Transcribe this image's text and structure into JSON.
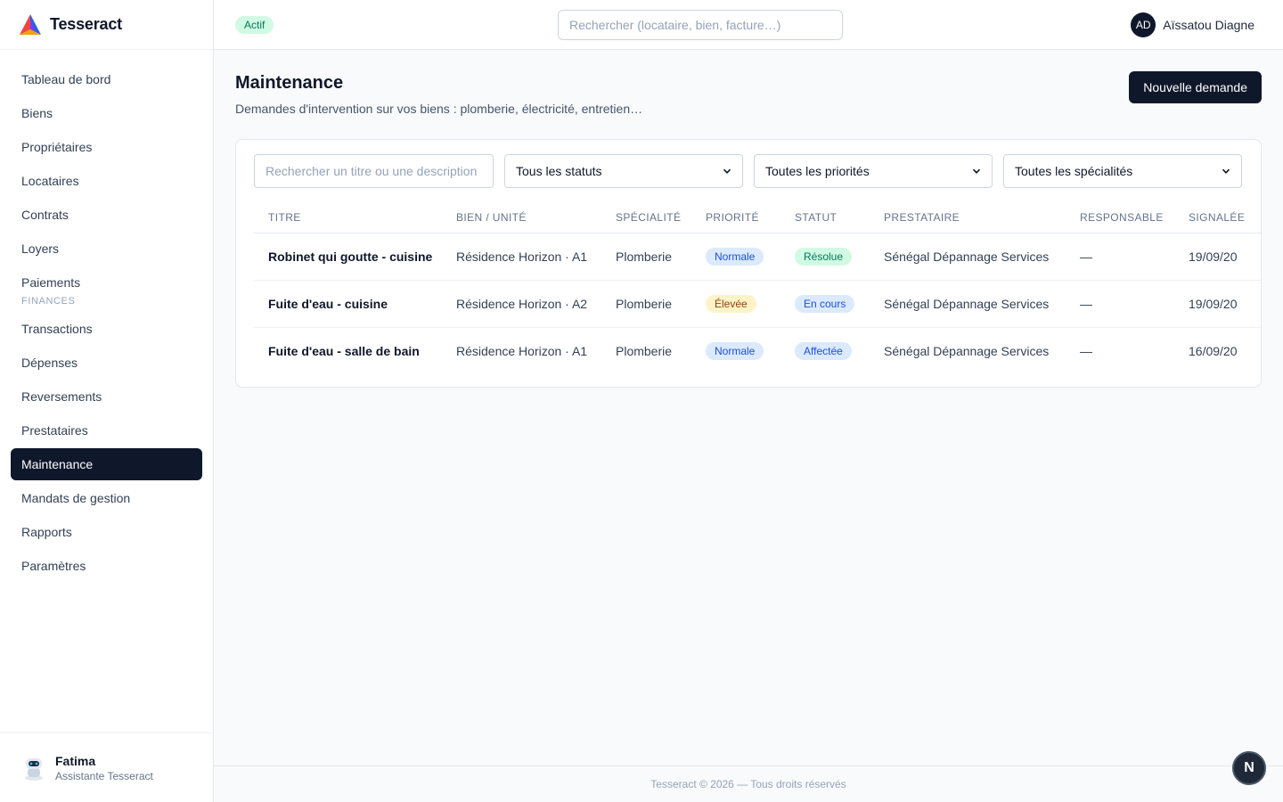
{
  "brand": {
    "name": "Tesseract"
  },
  "sidebar": {
    "items": [
      {
        "label": "Tableau de bord"
      },
      {
        "label": "Biens"
      },
      {
        "label": "Propriétaires"
      },
      {
        "label": "Locataires"
      },
      {
        "label": "Contrats"
      },
      {
        "label": "Loyers"
      },
      {
        "label": "Paiements"
      }
    ],
    "section_label": "FINANCES",
    "finance_items": [
      {
        "label": "Transactions"
      },
      {
        "label": "Dépenses"
      },
      {
        "label": "Reversements"
      },
      {
        "label": "Prestataires"
      },
      {
        "label": "Maintenance",
        "active": true
      },
      {
        "label": "Mandats de gestion"
      },
      {
        "label": "Rapports"
      },
      {
        "label": "Paramètres"
      }
    ],
    "assistant": {
      "name": "Fatima",
      "role": "Assistante Tesseract"
    }
  },
  "header": {
    "status": "Actif",
    "search_placeholder": "Rechercher (locataire, bien, facture…)",
    "user_initials": "AD",
    "user_name": "Aïssatou Diagne"
  },
  "page": {
    "title": "Maintenance",
    "subtitle": "Demandes d'intervention sur vos biens : plomberie, électricité, entretien…",
    "new_button": "Nouvelle demande"
  },
  "filters": {
    "search_placeholder": "Rechercher un titre ou une description",
    "status": "Tous les statuts",
    "priority": "Toutes les priorités",
    "specialty": "Toutes les spécialités"
  },
  "table": {
    "columns": [
      "TITRE",
      "BIEN / UNITÉ",
      "SPÉCIALITÉ",
      "PRIORITÉ",
      "STATUT",
      "PRESTATAIRE",
      "RESPONSABLE",
      "SIGNALÉE"
    ],
    "rows": [
      {
        "title": "Robinet qui goutte - cuisine",
        "unit": "Résidence Horizon · A1",
        "specialty": "Plomberie",
        "priority": "Normale",
        "status": "Résolue",
        "provider": "Sénégal Dépannage Services",
        "owner": "—",
        "reported": "19/09/20"
      },
      {
        "title": "Fuite d'eau - cuisine",
        "unit": "Résidence Horizon · A2",
        "specialty": "Plomberie",
        "priority": "Élevée",
        "status": "En cours",
        "provider": "Sénégal Dépannage Services",
        "owner": "—",
        "reported": "19/09/20"
      },
      {
        "title": "Fuite d'eau - salle de bain",
        "unit": "Résidence Horizon · A1",
        "specialty": "Plomberie",
        "priority": "Normale",
        "status": "Affectée",
        "provider": "Sénégal Dépannage Services",
        "owner": "—",
        "reported": "16/09/20"
      }
    ]
  },
  "badge_colors": {
    "Normale": {
      "bg": "#dbeafe",
      "fg": "#1d4ed8"
    },
    "Élevée": {
      "bg": "#fef3c7",
      "fg": "#92400e"
    },
    "Résolue": {
      "bg": "#d1fae5",
      "fg": "#047857"
    },
    "En cours": {
      "bg": "#dbeafe",
      "fg": "#1d4ed8"
    },
    "Affectée": {
      "bg": "#dbeafe",
      "fg": "#1d4ed8"
    }
  },
  "footer": {
    "text": "Tesseract © 2026 — Tous droits réservés"
  },
  "fab": {
    "label": "N"
  }
}
